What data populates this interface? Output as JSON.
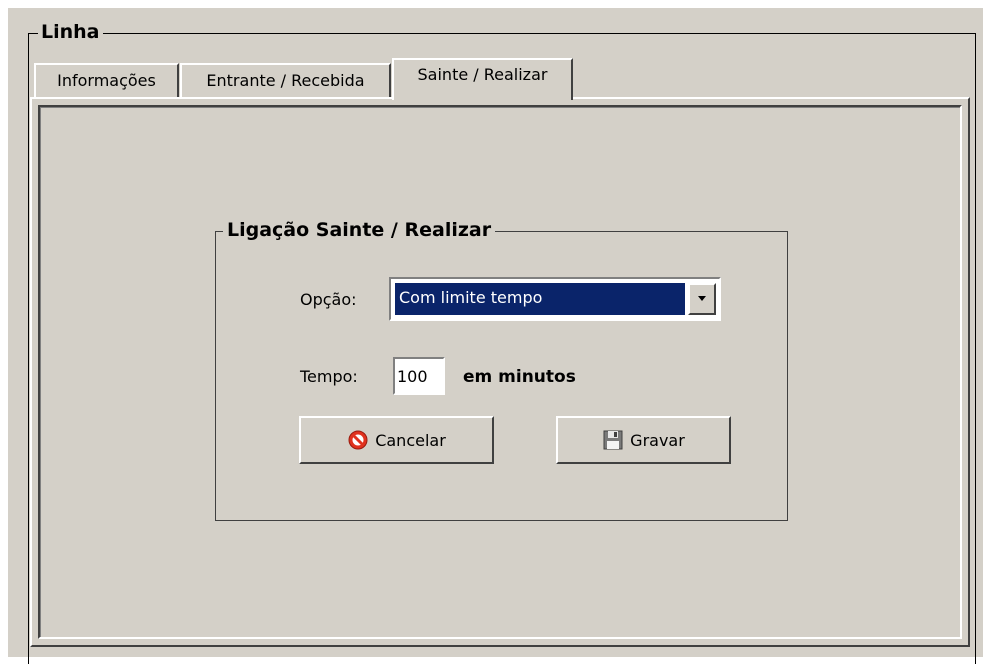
{
  "group_outer": {
    "title": "Linha"
  },
  "tabs": [
    {
      "label": "Informações",
      "active": false
    },
    {
      "label": "Entrante / Recebida",
      "active": false
    },
    {
      "label": "Sainte / Realizar",
      "active": true
    }
  ],
  "group_inner": {
    "title": "Ligação Sainte / Realizar"
  },
  "opcao": {
    "label": "Opção:",
    "selected": "Com limite tempo",
    "icon": "dropdown-arrow-icon"
  },
  "tempo": {
    "label": "Tempo:",
    "value": "100",
    "unit_label": "em minutos"
  },
  "buttons": {
    "cancel": {
      "label": "Cancelar",
      "icon": "cancel-icon"
    },
    "save": {
      "label": "Gravar",
      "icon": "save-disk-icon"
    }
  },
  "colors": {
    "face": "#d4d0c8",
    "selection": "#0a246a",
    "cancel_icon": "#e0321e"
  }
}
